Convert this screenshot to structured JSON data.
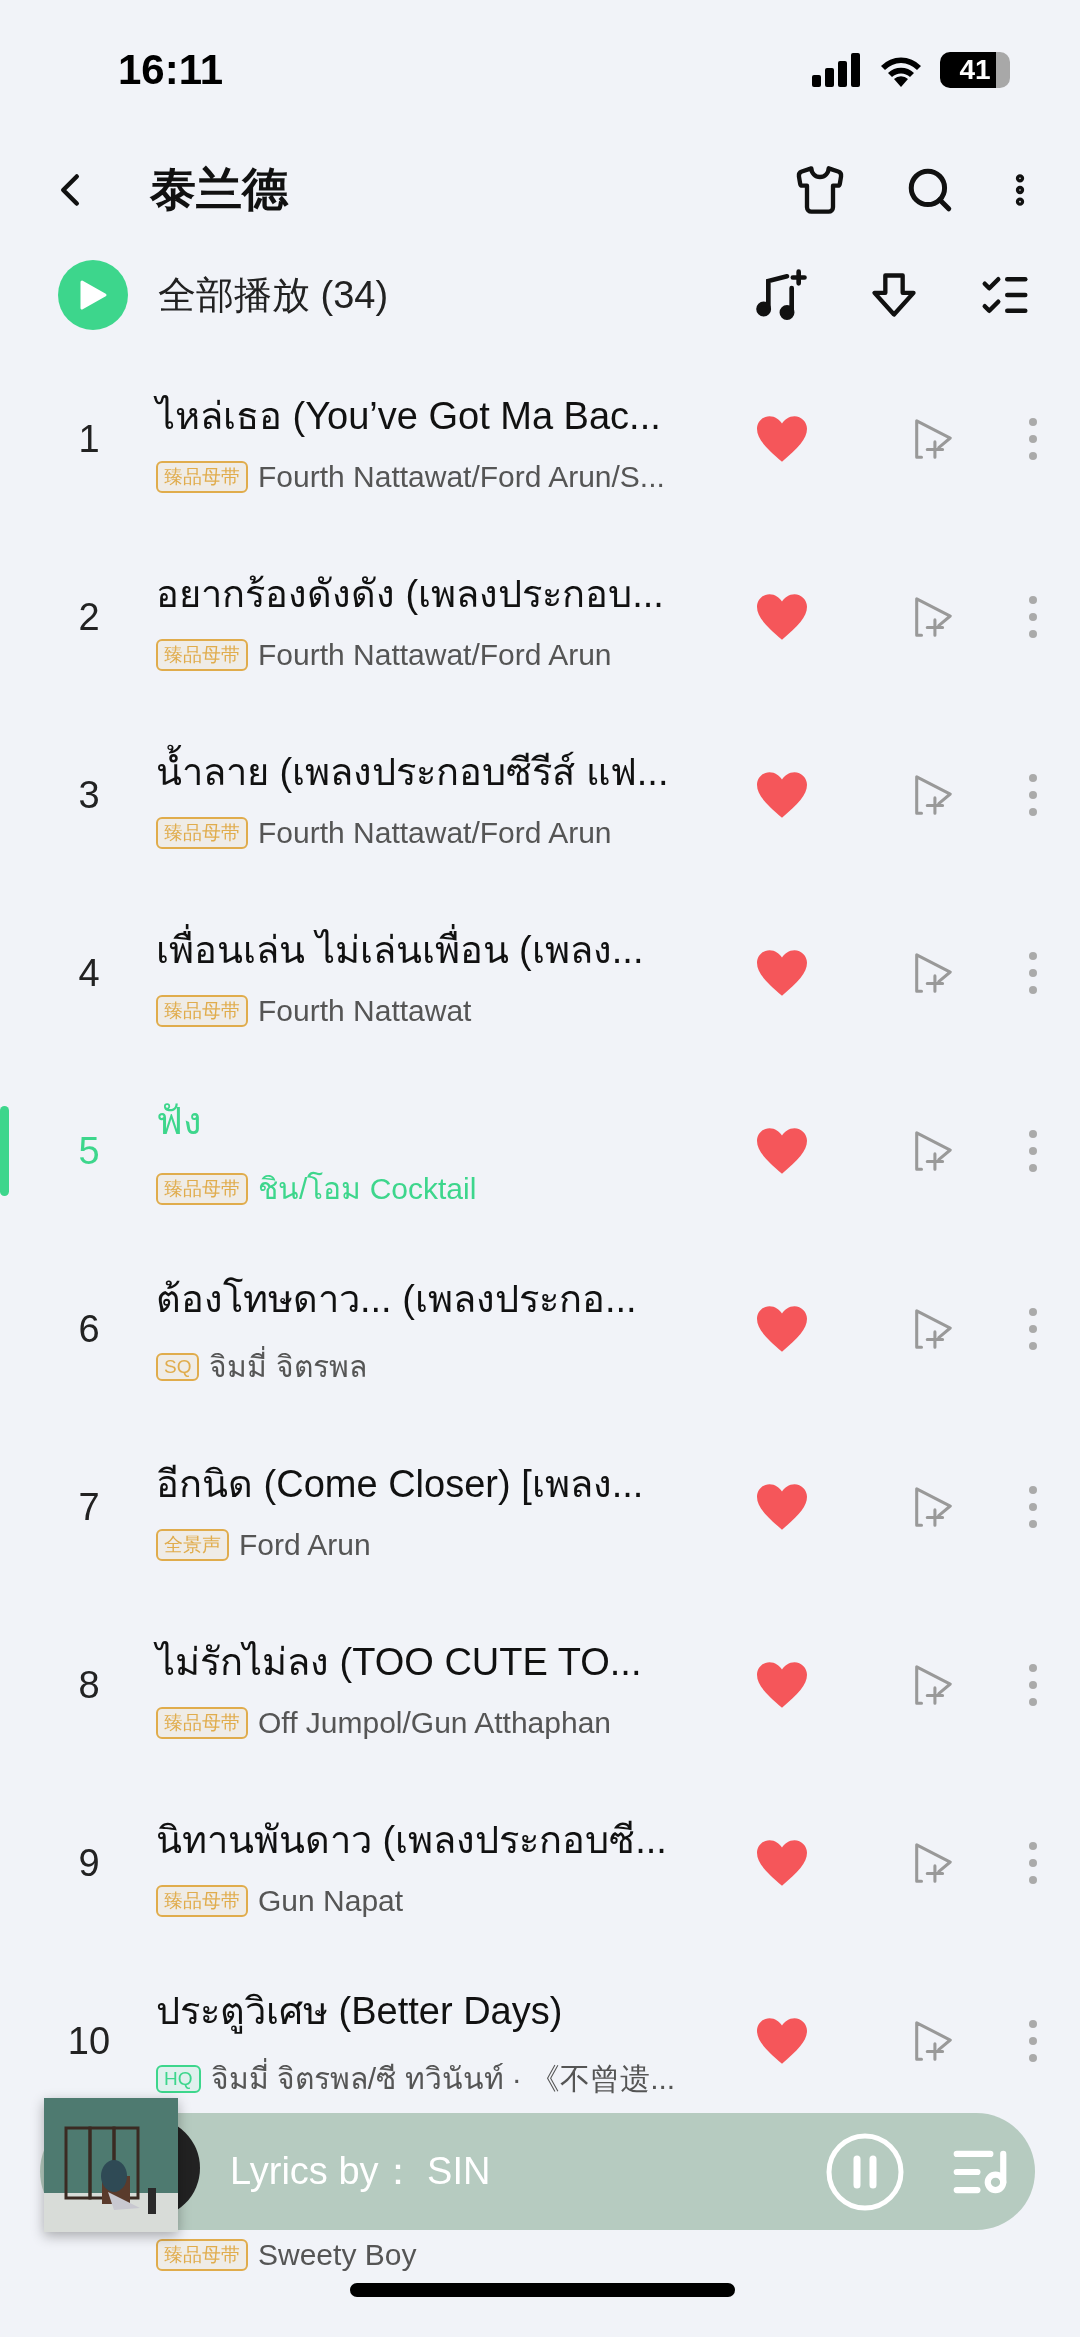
{
  "status_bar": {
    "time": "16:11",
    "battery": "41"
  },
  "header": {
    "title": "泰兰德"
  },
  "play_all": {
    "label": "全部播放 (34)"
  },
  "songs": [
    {
      "number": "1",
      "title": "ไหล่เธอ (You’ve Got Ma Bac...",
      "badge": {
        "text": "臻品母带",
        "color": "#e0ac4c"
      },
      "artist": "Fourth Nattawat/Ford Arun/S...",
      "liked": true,
      "selected": false
    },
    {
      "number": "2",
      "title": "อยากร้องดังดัง (เพลงประกอบ...",
      "badge": {
        "text": "臻品母带",
        "color": "#e0ac4c"
      },
      "artist": "Fourth Nattawat/Ford Arun",
      "liked": true,
      "selected": false
    },
    {
      "number": "3",
      "title": "น้ำลาย (เพลงประกอบซีรีส์ แฟ...",
      "badge": {
        "text": "臻品母带",
        "color": "#e0ac4c"
      },
      "artist": "Fourth Nattawat/Ford Arun",
      "liked": true,
      "selected": false
    },
    {
      "number": "4",
      "title": "เพื่อนเล่น ไม่เล่นเพื่อน  (เพลง...",
      "badge": {
        "text": "臻品母带",
        "color": "#e0ac4c"
      },
      "artist": "Fourth Nattawat",
      "liked": true,
      "selected": false
    },
    {
      "number": "5",
      "title": "ฟัง",
      "badge": {
        "text": "臻品母带",
        "color": "#e0ac4c"
      },
      "artist": "ชิน/โอม Cocktail",
      "liked": true,
      "selected": true
    },
    {
      "number": "6",
      "title": "ต้องโทษดาว...  (เพลงประกอ...",
      "badge": {
        "text": "SQ",
        "color": "#e0ac4c"
      },
      "artist": "จิมมี่ จิตรพล",
      "liked": true,
      "selected": false
    },
    {
      "number": "7",
      "title": "อีกนิด (Come Closer) [เพลง...",
      "badge": {
        "text": "全景声",
        "color": "#e0ac4c"
      },
      "artist": "Ford Arun",
      "liked": true,
      "selected": false
    },
    {
      "number": "8",
      "title": "ไม่รักไม่ลง (TOO CUTE TO...",
      "badge": {
        "text": "臻品母带",
        "color": "#e0ac4c"
      },
      "artist": "Off Jumpol/Gun Atthaphan",
      "liked": true,
      "selected": false
    },
    {
      "number": "9",
      "title": "นิทานพันดาว (เพลงประกอบซี...",
      "badge": {
        "text": "臻品母带",
        "color": "#e0ac4c"
      },
      "artist": "Gun Napat",
      "liked": true,
      "selected": false
    },
    {
      "number": "10",
      "title": "ประตูวิเศษ (Better Days)",
      "badge": {
        "text": "HQ",
        "color": "#3dd68c"
      },
      "artist": "จิมมี่ จิตรพล/ซี ทวินันท์ · 《不曾遗...",
      "liked": true,
      "selected": false
    }
  ],
  "partial_song": {
    "badge": {
      "text": "臻品母带",
      "color": "#e0ac4c"
    },
    "artist": "Sweety Boy"
  },
  "player": {
    "text": "Lyrics by： SIN",
    "playing": true
  }
}
